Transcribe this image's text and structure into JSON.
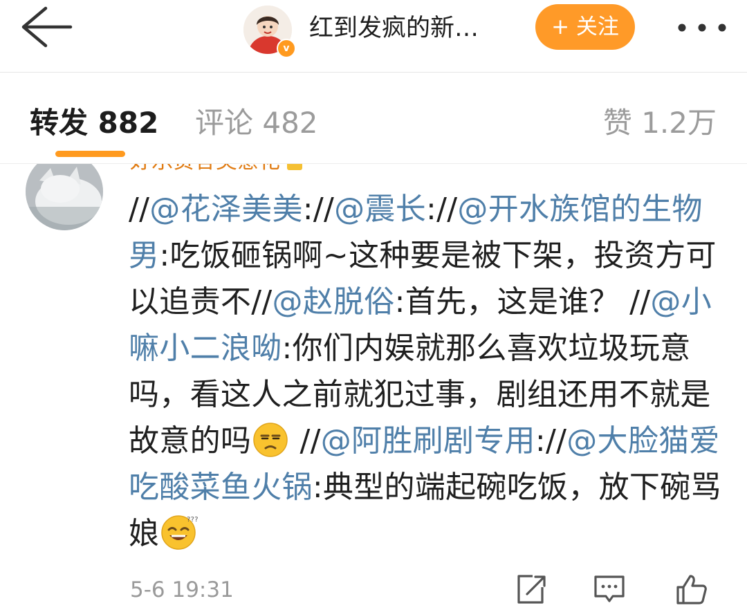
{
  "header": {
    "title": "红到发疯的新…",
    "follow_label": "关注",
    "follow_plus": "+",
    "avatar_badge": "v",
    "accent": "#ff9a28"
  },
  "tabs": {
    "repost": "转发 882",
    "comment": "评论 482",
    "like": "赞 1.2万"
  },
  "post": {
    "username": "好乐贵答美意花",
    "segments": [
      {
        "t": "//",
        "m": false
      },
      {
        "t": "@花泽美美",
        "m": true
      },
      {
        "t": "://",
        "m": false
      },
      {
        "t": "@震长",
        "m": true
      },
      {
        "t": "://",
        "m": false
      },
      {
        "t": "@开水族馆的生物男",
        "m": true
      },
      {
        "t": ":吃饭砸锅啊~这种要是被下架，投资方可以追责不//",
        "m": false
      },
      {
        "t": "@赵脱俗",
        "m": true
      },
      {
        "t": ":首先，这是谁？ //",
        "m": false
      },
      {
        "t": "@小嘛小二浪呦",
        "m": true
      },
      {
        "t": ":你们内娱就那么喜欢垃圾玩意吗，看这人之前就犯过事，剧组还用不就是故意的吗",
        "m": false
      },
      {
        "emoji": "unamused-emoji"
      },
      {
        "t": " //",
        "m": false
      },
      {
        "t": "@阿胜刷剧专用",
        "m": true
      },
      {
        "t": "://",
        "m": false
      },
      {
        "t": "@大脸猫爱吃酸菜鱼火锅",
        "m": true
      },
      {
        "t": ":典型的端起碗吃饭，放下碗骂娘",
        "m": false
      },
      {
        "emoji": "dizzy-grin-emoji"
      }
    ],
    "time": "5-6 19:31",
    "mention_color": "#4f7fa9"
  }
}
